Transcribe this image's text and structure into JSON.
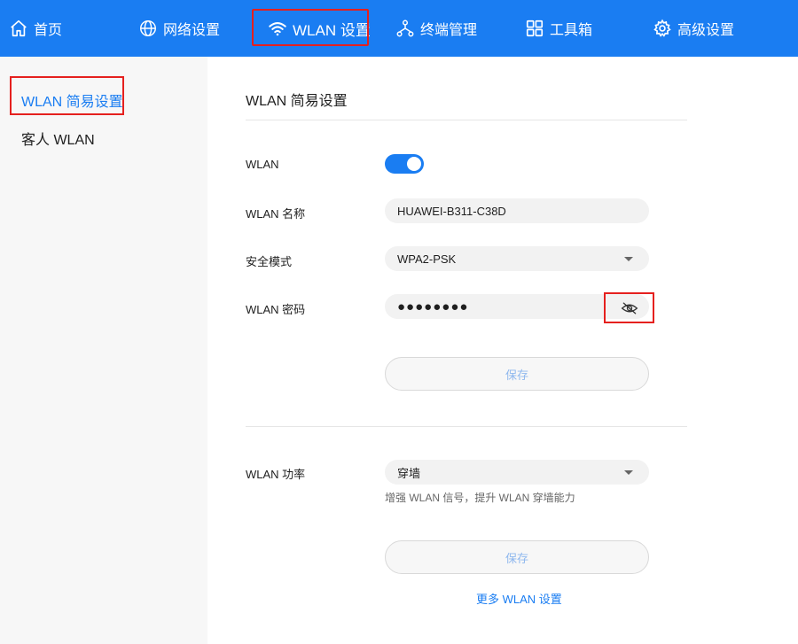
{
  "nav": {
    "items": [
      {
        "label": "首页",
        "icon": "home-icon"
      },
      {
        "label": "网络设置",
        "icon": "globe-icon"
      },
      {
        "label": "WLAN 设置",
        "icon": "wifi-icon"
      },
      {
        "label": "终端管理",
        "icon": "devices-icon"
      },
      {
        "label": "工具箱",
        "icon": "grid-icon"
      },
      {
        "label": "高级设置",
        "icon": "gear-icon"
      }
    ],
    "active_index": 2
  },
  "sidebar": {
    "items": [
      {
        "label": "WLAN 简易设置"
      },
      {
        "label": "客人 WLAN"
      }
    ],
    "active_index": 0
  },
  "main": {
    "title": "WLAN 简易设置",
    "wlan": {
      "label": "WLAN",
      "enabled": true
    },
    "ssid": {
      "label": "WLAN 名称",
      "value": "HUAWEI-B311-C38D"
    },
    "security": {
      "label": "安全模式",
      "value": "WPA2-PSK"
    },
    "password": {
      "label": "WLAN 密码",
      "value": "●●●●●●●●"
    },
    "save_label": "保存",
    "power": {
      "label": "WLAN 功率",
      "value": "穿墙",
      "hint": "增强 WLAN 信号，提升 WLAN 穿墙能力"
    },
    "save2_label": "保存",
    "more_link": "更多 WLAN 设置"
  },
  "colors": {
    "brand": "#1a7df2",
    "highlight_box": "#e5201e",
    "sidebar_bg": "#f7f7f7",
    "field_bg": "#f2f2f2"
  }
}
